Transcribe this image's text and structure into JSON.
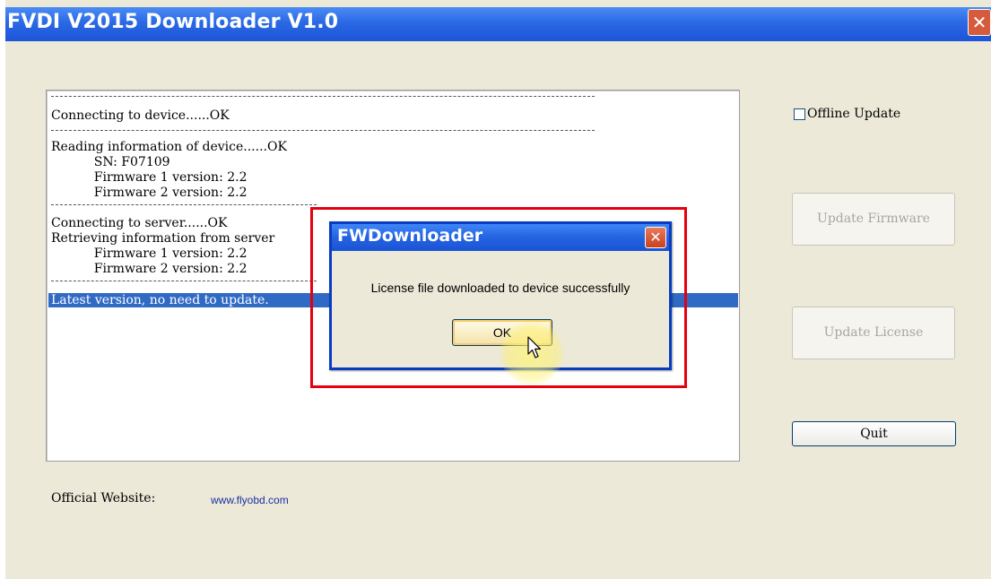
{
  "window": {
    "title": "FVDI  V2015 Downloader V1.0",
    "close_glyph": "✕"
  },
  "log": {
    "lines": [
      "Connecting to device......OK",
      "Reading information of device......OK",
      "    SN: F07109",
      "    Firmware 1 version: 2.2",
      "    Firmware 2 version: 2.2",
      "Connecting to server......OK",
      "Retrieving information from server",
      "    Firmware 1 version: 2.2",
      "    Firmware 2 version: 2.2",
      "Latest version, no need to update."
    ]
  },
  "controls": {
    "offline_update_label": "Offline Update",
    "offline_update_checked": false,
    "update_firmware_label": "Update Firmware",
    "update_license_label": "Update License",
    "quit_label": "Quit"
  },
  "footer": {
    "label": "Official Website:",
    "link_text": "www.flyobd.com"
  },
  "dialog": {
    "title": "FWDownloader",
    "message": "License file downloaded to device successfully",
    "ok_label": "OK",
    "close_glyph": "✕"
  },
  "colors": {
    "titlebar_blue": "#2a68e4",
    "selection_blue": "#316ac5",
    "annotation_red": "#e3000f",
    "window_bg": "#ece9d8"
  },
  "icons": [
    "close-icon",
    "dialog-close-icon",
    "mouse-pointer-icon"
  ]
}
